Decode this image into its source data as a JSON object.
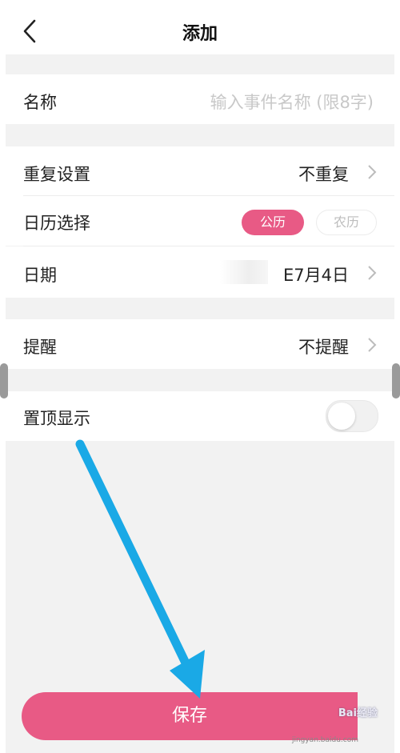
{
  "header": {
    "title": "添加"
  },
  "name_row": {
    "label": "名称",
    "placeholder": "输入事件名称 (限8字)"
  },
  "repeat_row": {
    "label": "重复设置",
    "value": "不重复"
  },
  "calendar_row": {
    "label": "日历选择",
    "options": [
      "公历",
      "农历"
    ],
    "selected": "公历"
  },
  "date_row": {
    "label": "日期",
    "value": "E7月4日"
  },
  "reminder_row": {
    "label": "提醒",
    "value": "不提醒"
  },
  "pin_row": {
    "label": "置顶显示",
    "enabled": false
  },
  "save_button": {
    "label": "保存"
  },
  "watermark": {
    "text": "Bai经验",
    "sub": "jingyan.baidu.com"
  },
  "colors": {
    "accent": "#e85a85",
    "arrow": "#1aa9e6",
    "background": "#f2f2f2"
  }
}
